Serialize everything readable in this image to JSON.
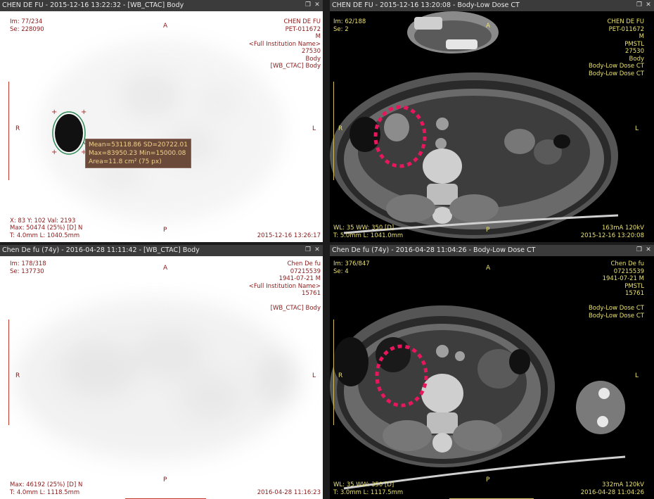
{
  "viewports": {
    "top_left": {
      "title": "CHEN DE FU  - 2015-12-16 13:22:32 - [WB_CTAC] Body",
      "tl": [
        "Im: 77/234",
        "Se: 228090"
      ],
      "tr": [
        "CHEN DE FU",
        "PET-011672",
        "M",
        "<Full Institution Name>",
        "27530",
        "Body",
        "[WB_CTAC] Body"
      ],
      "bl": [
        "X: 83 Y: 102 Val: 2193",
        "Max: 50474 (25%) [D] N",
        "T: 4.0mm L: 1040.5mm"
      ],
      "br": [
        "2015-12-16 13:26:17"
      ],
      "orient": {
        "top": "A",
        "bottom": "P",
        "left": "R",
        "right": "L"
      },
      "roi": [
        "Mean=53118.86 SD=20722.01",
        "Max=83950.23 Min=15000.08",
        "Area=11.8 cm² (75 px)"
      ]
    },
    "top_right": {
      "title": "CHEN DE FU  - 2015-12-16 13:20:08 - Body-Low Dose CT",
      "tl": [
        "Im: 62/188",
        "Se: 2"
      ],
      "tr": [
        "CHEN DE FU",
        "PET-011672",
        "M",
        "PMSTL",
        "27530",
        "Body",
        "Body-Low Dose CT",
        "Body-Low Dose CT"
      ],
      "bl": [
        "WL: 35 WW: 350 [D]",
        "T: 5.0mm L: 1041.0mm"
      ],
      "br": [
        "163mA 120kV",
        "2015-12-16 13:20:08"
      ],
      "orient": {
        "top": "A",
        "bottom": "P",
        "left": "R",
        "right": "L"
      }
    },
    "bottom_left": {
      "title": "Chen De fu (74y)  - 2016-04-28 11:11:42 - [WB_CTAC] Body",
      "tl": [
        "Im: 178/318",
        "Se: 137730"
      ],
      "tr": [
        "Chen De fu",
        "07215539",
        "1941-07-21 M",
        "<Full Institution Name>",
        "15761",
        "",
        "[WB_CTAC] Body"
      ],
      "bl": [
        "Max: 46192 (25%) [D] N",
        "T: 4.0mm L: 1118.5mm"
      ],
      "br": [
        "2016-04-28 11:16:23"
      ],
      "orient": {
        "top": "A",
        "bottom": "P",
        "left": "R",
        "right": "L"
      }
    },
    "bottom_right": {
      "title": "Chen De fu (74y)  - 2016-04-28 11:04:26 - Body-Low Dose CT",
      "tl": [
        "Im: 376/847",
        "Se: 4"
      ],
      "tr": [
        "Chen De fu",
        "07215539",
        "1941-07-21 M",
        "PMSTL",
        "15761",
        "",
        "Body-Low Dose CT",
        "Body-Low Dose CT"
      ],
      "bl": [
        "WL: 35 WW: 350 [D]",
        "T: 3.0mm L: 1117.5mm"
      ],
      "br": [
        "332mA 120kV",
        "2016-04-28 11:04:26"
      ],
      "orient": {
        "top": "A",
        "bottom": "P",
        "left": "R",
        "right": "L"
      }
    }
  },
  "icons": {
    "restore": "restore-icon",
    "close": "close-icon"
  },
  "colors": {
    "pet_text": "#8b1a1a",
    "ct_text": "#e8e070",
    "roi_outline": "#2e8b57",
    "annotation": "#e8175d"
  }
}
